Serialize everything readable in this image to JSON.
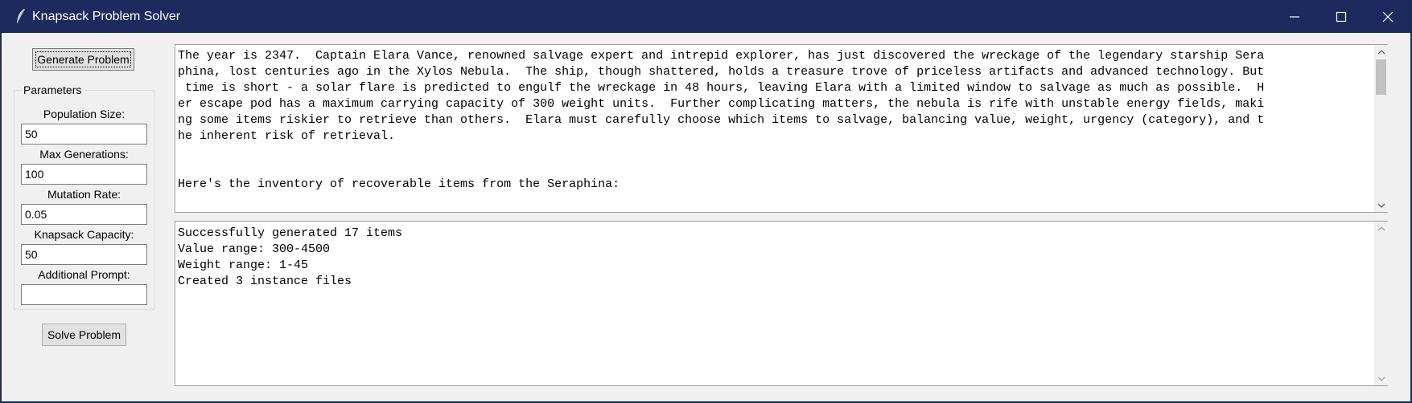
{
  "window": {
    "title": "Knapsack Problem Solver",
    "titlebar_color": "#1c2a5e"
  },
  "sidebar": {
    "generate_label": "Generate Problem",
    "solve_label": "Solve Problem",
    "parameters_label": "Parameters",
    "fields": [
      {
        "label": "Population Size:",
        "value": "50"
      },
      {
        "label": "Max Generations:",
        "value": "100"
      },
      {
        "label": "Mutation Rate:",
        "value": "0.05"
      },
      {
        "label": "Knapsack Capacity:",
        "value": "50"
      },
      {
        "label": "Additional Prompt:",
        "value": ""
      }
    ]
  },
  "story_pane": {
    "lines": [
      "The year is 2347.  Captain Elara Vance, renowned salvage expert and intrepid explorer, has just discovered the wreckage of the legendary starship Sera",
      "phina, lost centuries ago in the Xylos Nebula.  The ship, though shattered, holds a treasure trove of priceless artifacts and advanced technology. But",
      " time is short - a solar flare is predicted to engulf the wreckage in 48 hours, leaving Elara with a limited window to salvage as much as possible.  H",
      "er escape pod has a maximum carrying capacity of 300 weight units.  Further complicating matters, the nebula is rife with unstable energy fields, maki",
      "ng some items riskier to retrieve than others.  Elara must carefully choose which items to salvage, balancing value, weight, urgency (category), and t",
      "he inherent risk of retrieval.",
      "",
      "",
      "Here's the inventory of recoverable items from the Seraphina:"
    ]
  },
  "log_pane": {
    "lines": [
      "Successfully generated 17 items",
      "Value range: 300-4500",
      "Weight range: 1-45",
      "Created 3 instance files"
    ]
  },
  "icons": {
    "app": "feather-icon",
    "minimize": "minimize-icon",
    "maximize": "maximize-icon",
    "close": "close-icon"
  }
}
